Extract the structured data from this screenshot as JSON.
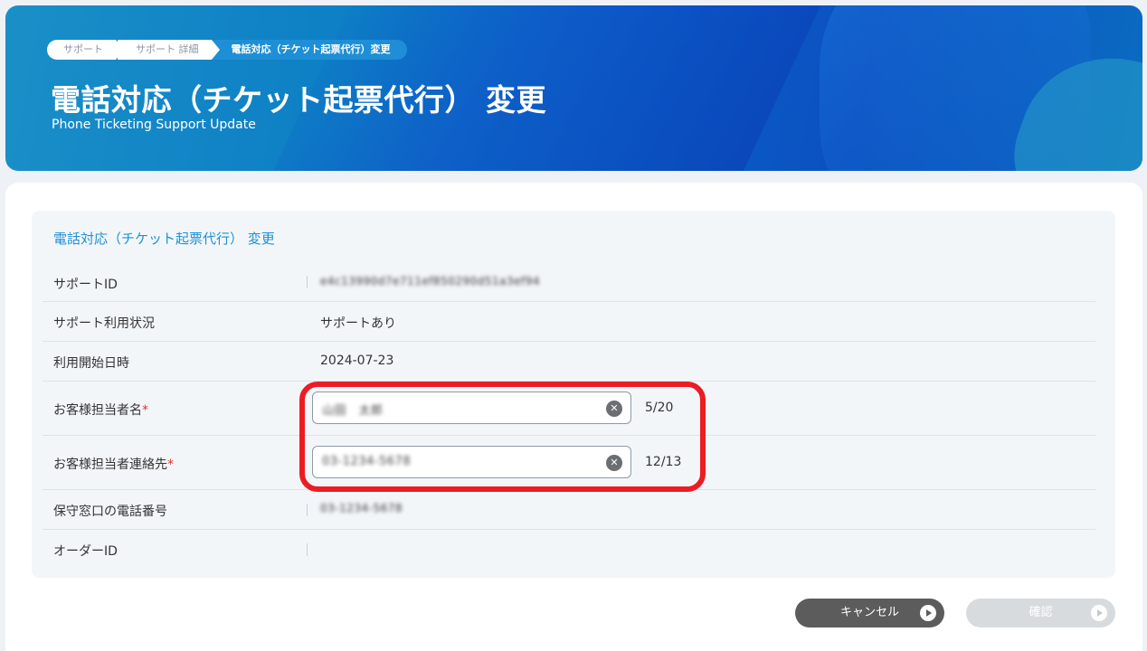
{
  "breadcrumb": {
    "items": [
      "サポート",
      "サポート 詳細"
    ],
    "current": "電話対応（チケット起票代行）変更"
  },
  "hero": {
    "title": "電話対応（チケット起票代行） 変更",
    "subtitle": "Phone Ticketing Support Update"
  },
  "panel": {
    "title": "電話対応（チケット起票代行） 変更",
    "rows": {
      "support_id": {
        "label": "サポートID",
        "value": "e4c13990d7e711ef850290d51a3ef94"
      },
      "usage_status": {
        "label": "サポート利用状況",
        "value": "サポートあり"
      },
      "start_date": {
        "label": "利用開始日時",
        "value": "2024-07-23"
      },
      "customer_name": {
        "label": "お客様担当者名",
        "required_mark": "*",
        "value": "山田　太郎",
        "counter": "5/20"
      },
      "customer_contact": {
        "label": "お客様担当者連絡先",
        "required_mark": "*",
        "value": "03-1234-5678",
        "counter": "12/13"
      },
      "maintenance_phone": {
        "label": "保守窓口の電話番号",
        "value": "03-1234-5678"
      },
      "order_id": {
        "label": "オーダーID",
        "value": ""
      }
    }
  },
  "buttons": {
    "cancel": "キャンセル",
    "confirm": "確認"
  },
  "colors": {
    "accent": "#1e8fd6",
    "required": "#e0302f",
    "highlight": "#ec1c24"
  },
  "icons": {
    "clear": "clear-circle-icon",
    "play": "play-circle-icon"
  }
}
